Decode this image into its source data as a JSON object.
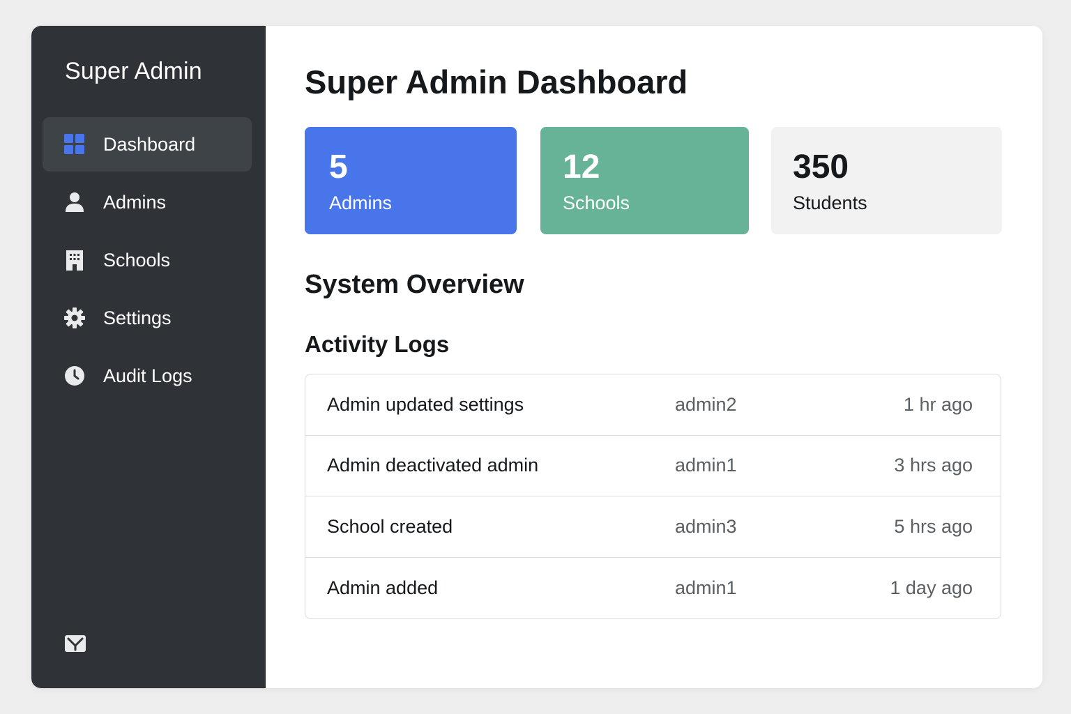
{
  "sidebar": {
    "brand": "Super Admin",
    "items": [
      {
        "label": "Dashboard",
        "icon": "dashboard-grid-icon",
        "active": true
      },
      {
        "label": "Admins",
        "icon": "user-icon",
        "active": false
      },
      {
        "label": "Schools",
        "icon": "building-icon",
        "active": false
      },
      {
        "label": "Settings",
        "icon": "gear-icon",
        "active": false
      },
      {
        "label": "Audit Logs",
        "icon": "clock-icon",
        "active": false
      }
    ],
    "bottom_icon": "mail-icon"
  },
  "main": {
    "title": "Super Admin Dashboard",
    "stats": [
      {
        "value": "5",
        "label": "Admins",
        "color": "#4876ea"
      },
      {
        "value": "12",
        "label": "Schools",
        "color": "#67b398"
      },
      {
        "value": "350",
        "label": "Students",
        "color": "#f2f2f2"
      }
    ],
    "overview_title": "System Overview",
    "activity_title": "Activity Logs",
    "logs": [
      {
        "action": "Admin updated settings",
        "user": "admin2",
        "time": "1 hr ago"
      },
      {
        "action": "Admin deactivated admin",
        "user": "admin1",
        "time": "3 hrs ago"
      },
      {
        "action": "School created",
        "user": "admin3",
        "time": "5 hrs ago"
      },
      {
        "action": "Admin added",
        "user": "admin1",
        "time": "1 day ago"
      }
    ]
  },
  "colors": {
    "sidebar_bg": "#2f3337",
    "active_item_bg": "#3e4348",
    "accent_blue": "#4876ea",
    "accent_green": "#67b398"
  }
}
